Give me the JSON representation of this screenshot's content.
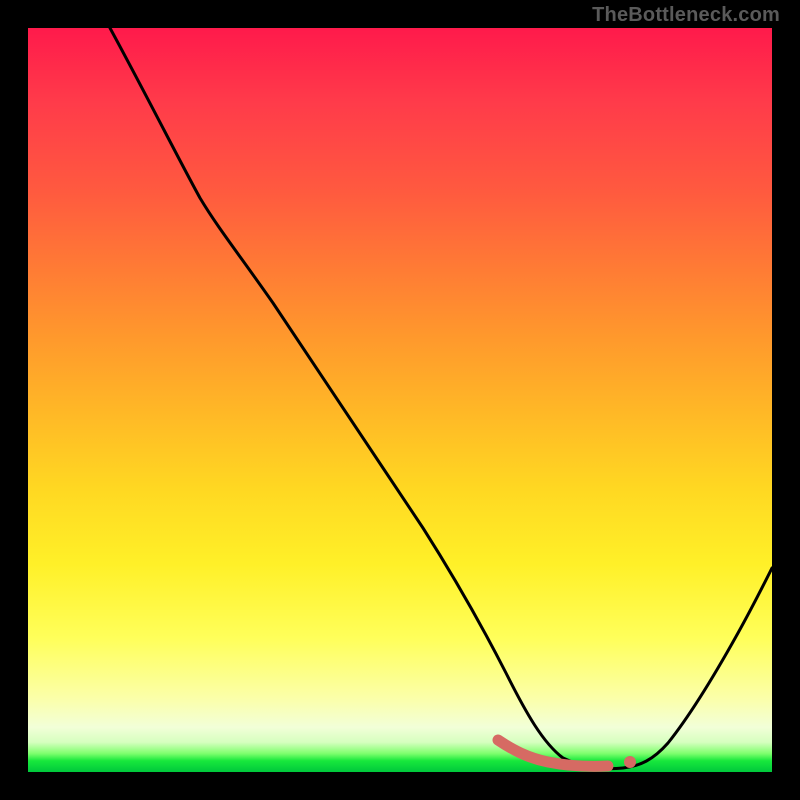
{
  "watermark": "TheBottleneck.com",
  "colors": {
    "page_background": "#000000",
    "watermark_text": "#5a5a5a",
    "curve_main": "#000000",
    "curve_accent": "#d66a63",
    "gradient_stops": [
      "#ff1a4b",
      "#ff3b4a",
      "#ff5a3f",
      "#ff7a35",
      "#ff9a2c",
      "#ffb926",
      "#ffd822",
      "#fff028",
      "#ffff5a",
      "#fbffa8",
      "#f2ffd8",
      "#d6ffbf",
      "#7fff6e",
      "#17e83c",
      "#00c83c"
    ]
  },
  "chart_data": {
    "type": "line",
    "title": "",
    "xlabel": "",
    "ylabel": "",
    "xlim": [
      0,
      100
    ],
    "ylim": [
      0,
      100
    ],
    "grid": false,
    "legend": false,
    "series": [
      {
        "name": "bottleneck-curve",
        "color": "#000000",
        "x": [
          11,
          18,
          22,
          26,
          30,
          35,
          40,
          45,
          50,
          55,
          60,
          63,
          66,
          69,
          72,
          75,
          78,
          80,
          82,
          85,
          88,
          92,
          96,
          100
        ],
        "y": [
          100,
          87,
          80,
          75,
          70,
          62,
          54,
          46,
          38,
          30,
          22,
          16,
          10,
          6,
          3,
          1.5,
          1,
          1,
          1.2,
          2.5,
          6,
          13,
          22,
          32
        ]
      },
      {
        "name": "highlight-segment",
        "color": "#d66a63",
        "x": [
          62,
          64,
          66,
          68,
          70,
          72,
          74,
          76,
          78,
          80
        ],
        "y": [
          3.5,
          3.0,
          2.6,
          2.3,
          2.1,
          2.0,
          2.0,
          2.1,
          2.3,
          2.6
        ]
      }
    ],
    "annotations": []
  }
}
